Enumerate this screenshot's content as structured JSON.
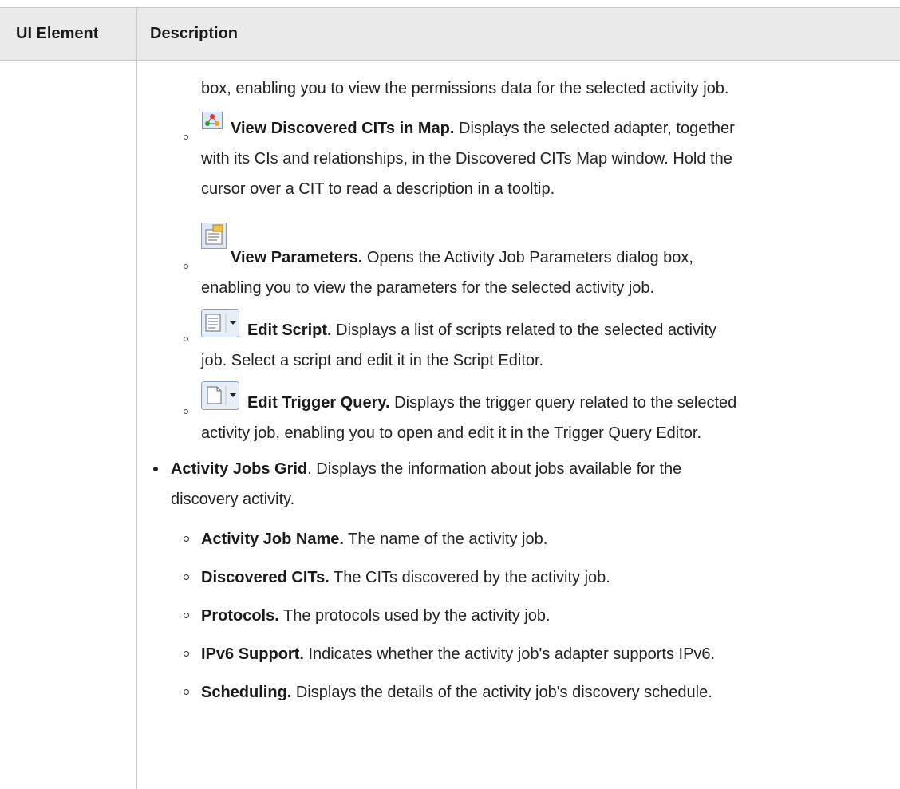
{
  "table": {
    "headers": [
      "UI Element",
      "Description"
    ]
  },
  "content": {
    "line1": "box, enabling you to view the permissions data for the selected activity job.",
    "map_item": {
      "icon": "discovered-cits-map-icon",
      "title": "View Discovered CITs in Map.",
      "text_a": " Displays the selected adapter, together",
      "text_b": "with its CIs and relationships, in the Discovered CITs Map window. Hold the",
      "text_c": "cursor over a CIT to read a description in a tooltip."
    },
    "params_item": {
      "icon": "view-parameters-icon",
      "title": "View Parameters.",
      "text_a": " Opens the Activity Job Parameters dialog box,",
      "text_b": "enabling you to view the parameters for the selected activity job."
    },
    "script_item": {
      "icon": "edit-script-dropdown-icon",
      "title": "Edit Script.",
      "text_a": " Displays a list of scripts related to the selected activity",
      "text_b": "job. Select a script and edit it in the Script Editor."
    },
    "trigger_item": {
      "icon": "edit-trigger-query-dropdown-icon",
      "title": "Edit Trigger Query.",
      "text_a": " Displays the trigger query related to the selected",
      "text_b": "activity job, enabling you to open and edit it in the Trigger Query Editor."
    },
    "grid_item": {
      "title": "Activity Jobs Grid",
      "text_a": ". Displays the information about jobs available for the",
      "text_b": "discovery activity."
    },
    "columns": [
      {
        "title": "Activity Job Name.",
        "text": " The name of the activity job."
      },
      {
        "title": "Discovered CITs.",
        "text": " The CITs discovered by the activity job."
      },
      {
        "title": "Protocols.",
        "text": " The protocols used by the activity job."
      },
      {
        "title": "IPv6 Support.",
        "text": " Indicates whether the activity job's adapter supports IPv6."
      },
      {
        "title": "Scheduling.",
        "text": " Displays the details of the activity job's discovery schedule."
      }
    ]
  }
}
